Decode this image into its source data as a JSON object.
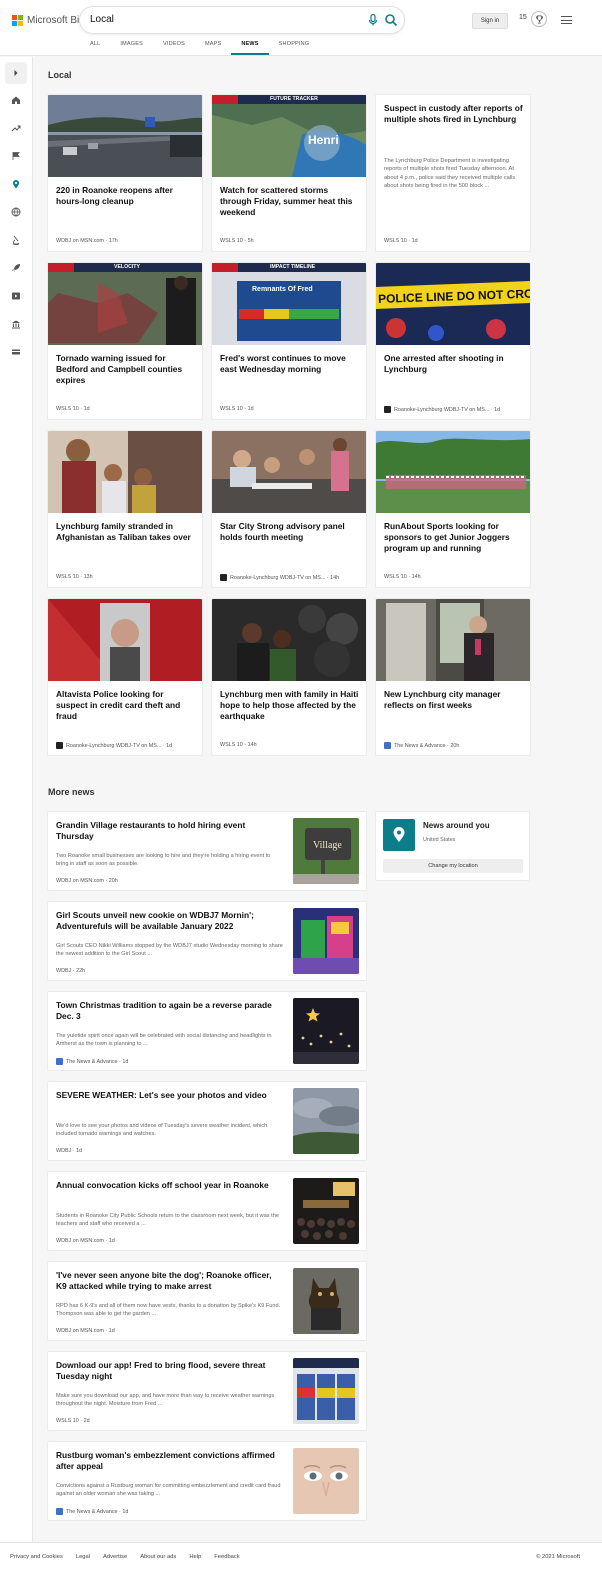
{
  "header": {
    "brand": "Microsoft Bing",
    "query": "Local",
    "sign_in": "Sign in",
    "rewards_count": "15"
  },
  "tabs": [
    "ALL",
    "IMAGES",
    "VIDEOS",
    "MAPS",
    "NEWS",
    "SHOPPING"
  ],
  "active_tab": "NEWS",
  "sidebar_icons": [
    "home-icon",
    "trending-icon",
    "flag-icon",
    "location-icon",
    "globe-icon",
    "science-icon",
    "rocket-icon",
    "video-icon",
    "politics-icon",
    "money-icon"
  ],
  "local": {
    "heading": "Local",
    "cards": [
      {
        "title": "220 in Roanoke reopens after hours-long cleanup",
        "source": "WDBJ on MSN.com",
        "time": "17h"
      },
      {
        "title": "Watch for scattered storms through Friday, summer heat this weekend",
        "source": "WSLS 10",
        "time": "5h",
        "overlay": "FUTURE TRACKER",
        "label": "Henri"
      },
      {
        "title": "Suspect in custody after reports of multiple shots fired in Lynchburg",
        "source": "WSLS 10",
        "time": "1d",
        "desc": "The Lynchburg Police Department is investigating reports of multiple shots fired Tuesday afternoon. At about 4 p.m., police said they received multiple calls about shots being fired in the 500 block ..."
      },
      {
        "title": "Tornado warning issued for Bedford and Campbell counties expires",
        "source": "WSLS 10",
        "time": "1d",
        "overlay": "VELOCITY"
      },
      {
        "title": "Fred's worst continues to move east Wednesday morning",
        "source": "WSLS 10",
        "time": "1d",
        "overlay": "IMPACT TIMELINE",
        "label": "Remnants Of Fred"
      },
      {
        "title": "One arrested after shooting in Lynchburg",
        "source": "Roanoke-Lynchburg WDBJ-TV on MS...",
        "time": "1d",
        "label": "POLICE LINE DO NOT CROSS"
      },
      {
        "title": "Lynchburg family stranded in Afghanistan as Taliban takes over",
        "source": "WSLS 10",
        "time": "13h"
      },
      {
        "title": "Star City Strong advisory panel holds fourth meeting",
        "source": "Roanoke-Lynchburg WDBJ-TV on MS...",
        "time": "14h"
      },
      {
        "title": "RunAbout Sports looking for sponsors to get Junior Joggers program up and running",
        "source": "WSLS 10",
        "time": "14h"
      },
      {
        "title": "Altavista Police looking for suspect in credit card theft and fraud",
        "source": "Roanoke-Lynchburg WDBJ-TV on MS...",
        "time": "1d"
      },
      {
        "title": "Lynchburg men with family in Haiti hope to help those affected by the earthquake",
        "source": "WSLS 10",
        "time": "14h"
      },
      {
        "title": "New Lynchburg city manager reflects on first weeks",
        "source": "The News & Advance",
        "time": "20h"
      }
    ]
  },
  "more_news": {
    "heading": "More news",
    "items": [
      {
        "title": "Grandin Village restaurants to hold hiring event Thursday",
        "desc": "Two Roanoke small businesses are looking to hire and they're holding a hiring event to bring in staff as soon as possible.",
        "source": "WDBJ on MSN.com",
        "time": "20h"
      },
      {
        "title": "Girl Scouts unveil new cookie on WDBJ7 Mornin'; Adventurefuls will be available January 2022",
        "desc": "Girl Scouts CEO Nikki Williams stopped by the WDBJ7 studio Wednesday morning to share the newest addition to the Girl Scout ...",
        "source": "WDBJ",
        "time": "22h"
      },
      {
        "title": "Town Christmas tradition to again be a reverse parade Dec. 3",
        "desc": "The yuletide spirit once again will be celebrated with social distancing and headlights in Amherst as the town is planning to ...",
        "source": "The News & Advance",
        "time": "1d"
      },
      {
        "title": "SEVERE WEATHER: Let's see your photos and video",
        "desc": "We'd love to see your photos and videos of Tuesday's severe weather incident, which included tornado warnings and watches.",
        "source": "WDBJ",
        "time": "1d"
      },
      {
        "title": "Annual convocation kicks off school year in Roanoke",
        "desc": "Students in Roanoke City Public Schools return to the classroom next week, but it was the teachers and staff who received a ...",
        "source": "WDBJ on MSN.com",
        "time": "1d"
      },
      {
        "title": "'I've never seen anyone bite the dog'; Roanoke officer, K9 attacked while trying to make arrest",
        "desc": "RPD has 6 K-9's and all of them now have vests, thanks to a donation by Spike's K9 Fund. Thompson was able to get the garden ...",
        "source": "WDBJ on MSN.com",
        "time": "1d"
      },
      {
        "title": "Download our app! Fred to bring flood, severe threat Tuesday night",
        "desc": "Make sure you download our app, and have more than way to receive weather warnings throughout the night. Moisture from Fred ...",
        "source": "WSLS 10",
        "time": "2d"
      },
      {
        "title": "Rustburg woman's embezzlement convictions affirmed after appeal",
        "desc": "Convictions against a Rustburg woman for committing embezzlement and credit card fraud against an older woman she was taking ...",
        "source": "The News & Advance",
        "time": "1d"
      }
    ]
  },
  "around": {
    "title": "News around you",
    "country": "United States",
    "button": "Change my location"
  },
  "footer": {
    "links": [
      "Privacy and Cookies",
      "Legal",
      "Advertise",
      "About our ads",
      "Help",
      "Feedback"
    ],
    "copyright": "© 2021 Microsoft"
  },
  "colors": {
    "accent": "#0c7d8a",
    "background": "#f6f6f6"
  }
}
